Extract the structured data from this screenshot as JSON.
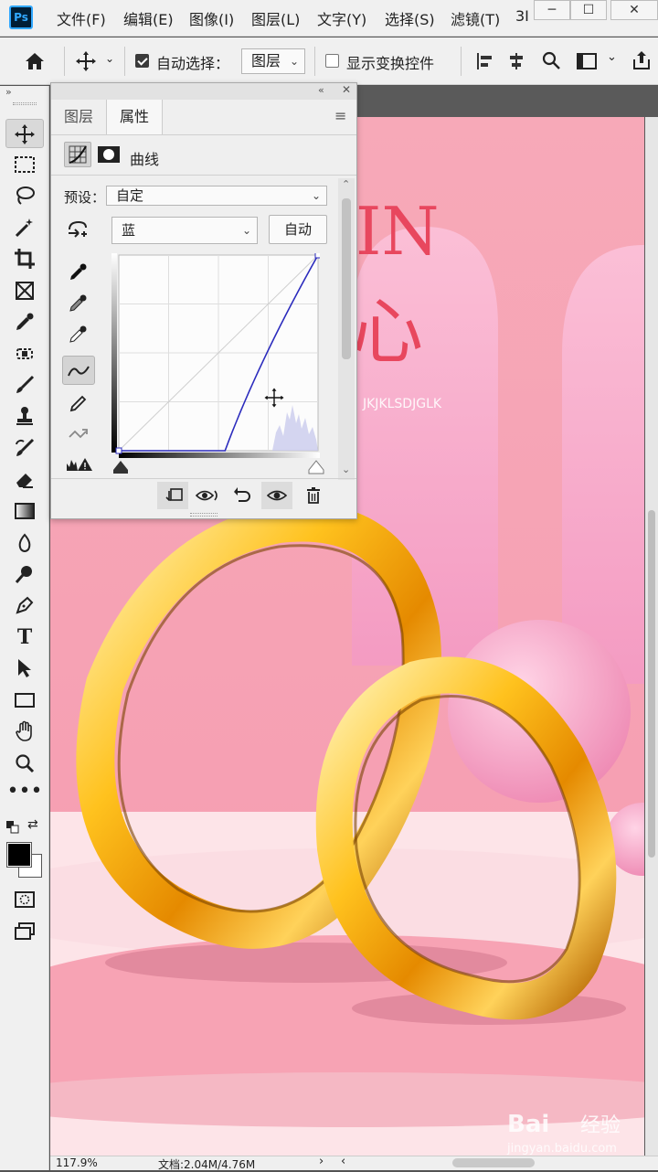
{
  "menubar": {
    "app_badge": "Ps",
    "items": [
      "文件(F)",
      "编辑(E)",
      "图像(I)",
      "图层(L)",
      "文字(Y)",
      "选择(S)",
      "滤镜(T)",
      "3I"
    ],
    "window_controls": [
      "─",
      "☐",
      "✕"
    ]
  },
  "options": {
    "home_icon": "home-icon",
    "move_icon": "move-icon",
    "auto_select_label": "自动选择：",
    "auto_select_checked": true,
    "target_value": "图层",
    "show_transform_label": "显示变换控件",
    "show_transform_checked": false
  },
  "toolbar": {
    "tools": [
      "move-tool",
      "marquee-tool",
      "lasso-tool",
      "magic-wand-tool",
      "crop-tool",
      "frame-tool",
      "eyedropper-tool",
      "spot-healing-tool",
      "brush-tool",
      "clone-stamp-tool",
      "history-brush-tool",
      "eraser-tool",
      "gradient-tool",
      "blur-tool",
      "dodge-tool",
      "pen-tool",
      "type-tool",
      "path-selection-tool",
      "rectangle-tool",
      "hand-tool",
      "zoom-tool",
      "more-tools"
    ]
  },
  "panel": {
    "tabs": [
      "图层",
      "属性"
    ],
    "active_tab": "属性",
    "adjustment_title": "曲线",
    "preset_label": "预设：",
    "preset_value": "自定",
    "channel_value": "蓝",
    "auto_button": "自动",
    "curve": {
      "channel_color": "#2b2bbd",
      "points": [
        [
          0,
          0
        ],
        [
          136,
          0
        ],
        [
          255,
          255
        ]
      ]
    }
  },
  "artwork": {
    "headline_fragment": "IN",
    "headline_char": "心",
    "subtitle_fragment": "JKJKLSDJGLK",
    "background_color": "#f7a2b3",
    "accent_color": "#e8475e"
  },
  "status": {
    "zoom": "117.9%",
    "doc_info": "文档:2.04M/4.76M"
  },
  "watermark": {
    "brand": "Bai",
    "brand2": "经验",
    "url": "jingyan.baidu.com"
  }
}
